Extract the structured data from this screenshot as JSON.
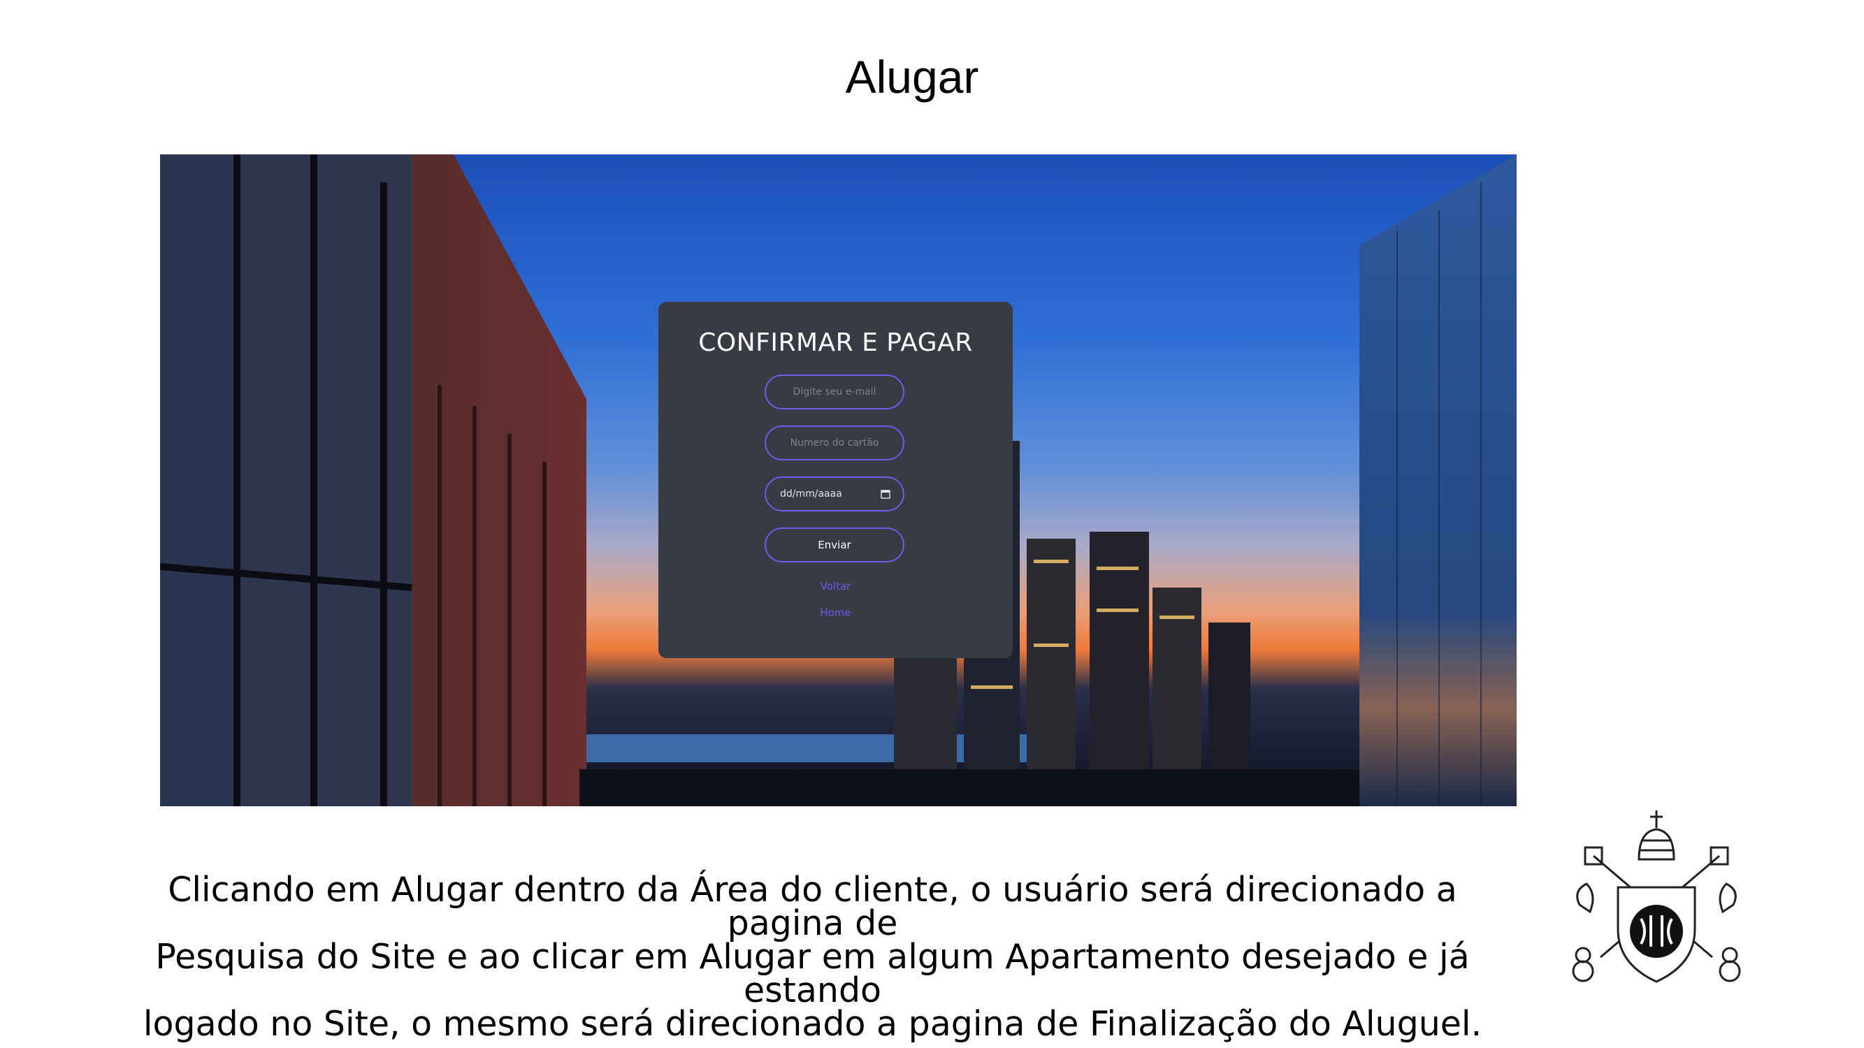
{
  "slide": {
    "title": "Alugar",
    "caption_lines": [
      "Clicando em Alugar dentro da Área do cliente, o usuário será direcionado a pagina de",
      "Pesquisa do Site e ao clicar em Alugar em algum Apartamento desejado e já estando",
      "logado no Site, o mesmo será direcionado a pagina de Finalização do Aluguel."
    ]
  },
  "modal": {
    "title": "CONFIRMAR E PAGAR",
    "email_placeholder": "Digite seu e-mail",
    "card_placeholder": "Numero do cartão",
    "date_placeholder": "dd/mm/aaaa",
    "submit_label": "Enviar",
    "back_link": "Voltar",
    "home_link": "Home"
  },
  "colors": {
    "modal_bg": "#363b44",
    "accent": "#6c5ce7"
  },
  "icons": {
    "date": "calendar-icon",
    "crest": "pucpr-crest-icon"
  }
}
